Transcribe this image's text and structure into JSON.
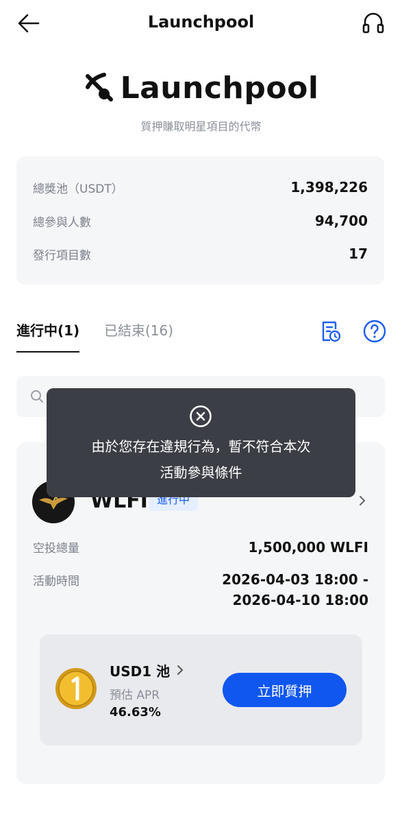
{
  "header": {
    "title": "Launchpool",
    "back_icon": "arrow-left-icon",
    "support_icon": "headset-icon"
  },
  "hero": {
    "logo_icon": "pickaxe-icon",
    "title": "Launchpool",
    "subtitle": "質押賺取明星項目的代幣"
  },
  "stats": [
    {
      "label": "總獎池（USDT）",
      "value": "1,398,226"
    },
    {
      "label": "總參與人數",
      "value": "94,700"
    },
    {
      "label": "發行項目數",
      "value": "17"
    }
  ],
  "tabs": {
    "active": "進行中(1)",
    "inactive": "已結束(16)",
    "record_icon": "history-record-icon",
    "help_icon": "question-circle-icon"
  },
  "search": {
    "icon": "search-icon",
    "placeholder": ""
  },
  "project": {
    "token_name": "WLFI",
    "status": "進行中",
    "airdrop_label": "空投總量",
    "airdrop_value": "1,500,000 WLFI",
    "time_label": "活動時間",
    "time_start": "2026-04-03 18:00 -",
    "time_end": "2026-04-10 18:00",
    "pool": {
      "name": "USD1 池",
      "apr_label": "預估 APR",
      "apr_value": "46.63%",
      "coin_icon": "usd1-coin-icon",
      "button": "立即質押"
    }
  },
  "toast": {
    "icon": "close-circle-icon",
    "line1": "由於您存在違規行為，暫不符合本次",
    "line2": "活動參與條件"
  },
  "colors": {
    "accent": "#1057f0",
    "badge_bg": "#e6efff",
    "card_bg": "#f5f6f8",
    "toast_bg": "#3b3e45"
  }
}
